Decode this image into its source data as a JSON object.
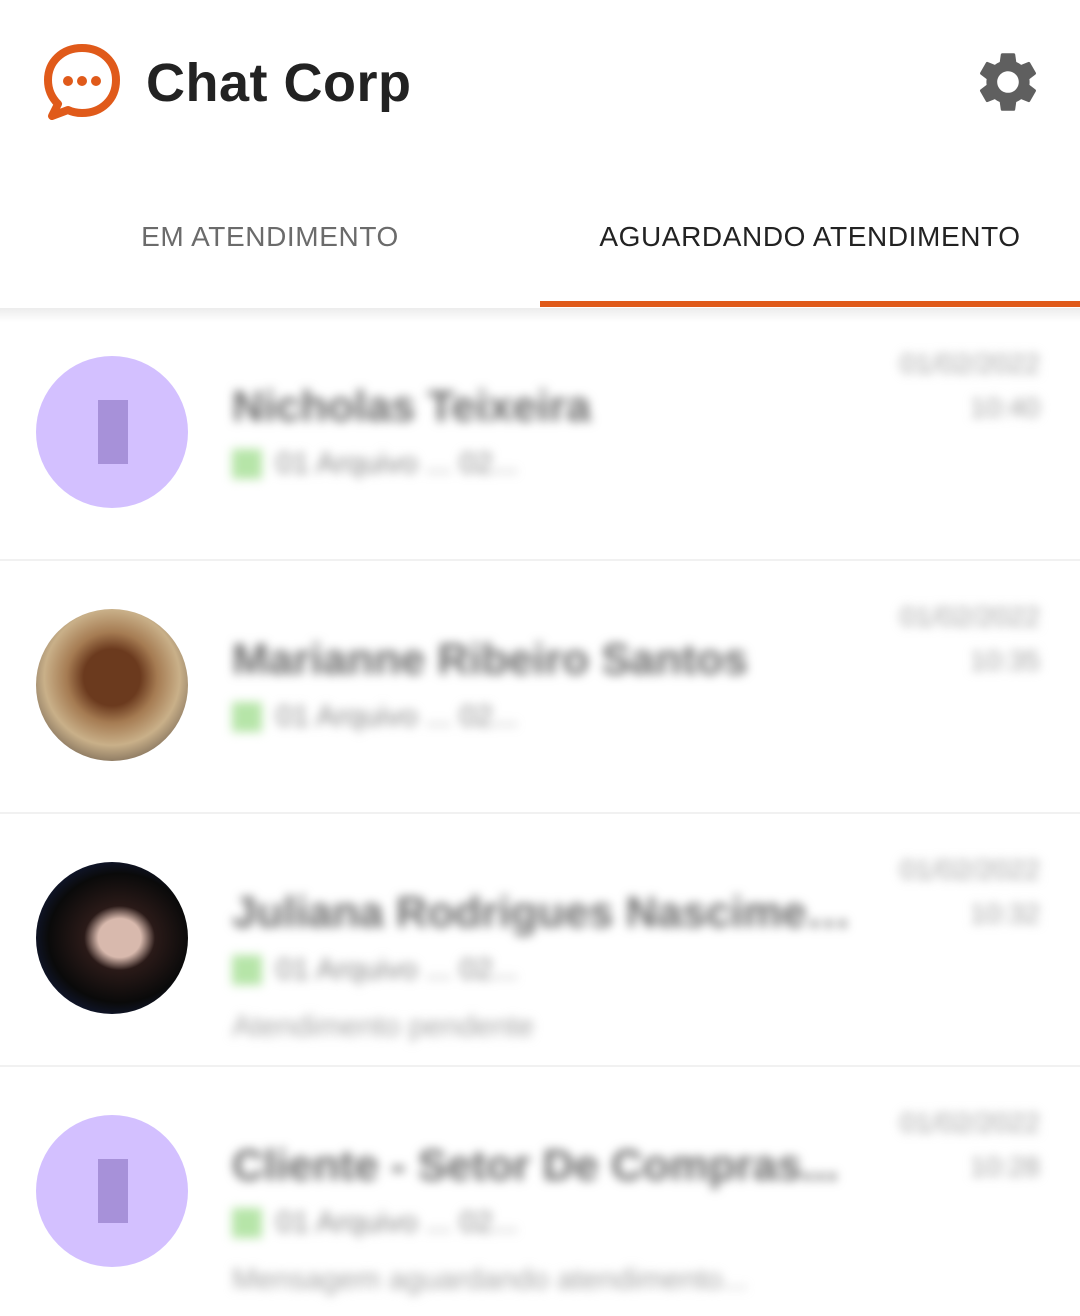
{
  "header": {
    "app_title": "Chat Corp",
    "logo_icon": "chat-bubble-dots-icon",
    "settings_icon": "gear-icon"
  },
  "tabs": [
    {
      "label": "EM ATENDIMENTO",
      "active": false
    },
    {
      "label": "AGUARDANDO ATENDIMENTO",
      "active": true
    }
  ],
  "colors": {
    "accent": "#e05a1a",
    "avatar_placeholder": "#d3c0ff",
    "read_check": "#b6e5a8"
  },
  "chats": [
    {
      "name": "Nicholas Teixeira",
      "preview": "01 Arquivo ... 02...",
      "date": "01/02/2022",
      "time": "10:40",
      "extra": "",
      "avatar": "placeholder"
    },
    {
      "name": "Marianne Ribeiro Santos",
      "preview": "01 Arquivo ... 02...",
      "date": "01/02/2022",
      "time": "10:35",
      "extra": "",
      "avatar": "photo"
    },
    {
      "name": "Juliana Rodrigues Nascimento...",
      "preview": "01 Arquivo ... 02...",
      "date": "01/02/2022",
      "time": "10:32",
      "extra": "Atendimento pendente",
      "avatar": "photo-dark"
    },
    {
      "name": "Cliente - Setor De Compras...",
      "preview": "01 Arquivo ... 02...",
      "date": "01/02/2022",
      "time": "10:28",
      "extra": "Mensagem aguardando atendimento...",
      "avatar": "placeholder"
    }
  ]
}
